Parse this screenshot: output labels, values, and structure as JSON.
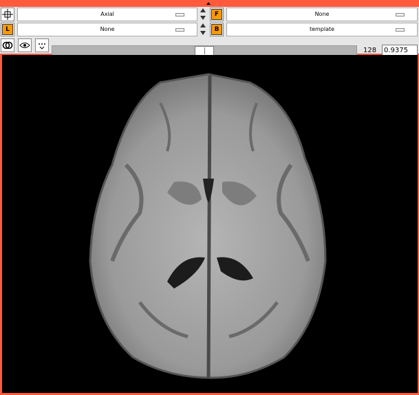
{
  "toolbar": {
    "view_select": "Axial",
    "overlay_select_top": "None",
    "overlay_select_left": "None",
    "template_select": "template",
    "slice_index": "128",
    "scale_value": "0.9375",
    "slice_position_fraction": 0.5
  },
  "badges": {
    "f_label": "F",
    "l_label": "L",
    "b_label": "B"
  },
  "icons": [
    "crosshair-icon",
    "layer-icon",
    "link-rings-icon",
    "eye-icon",
    "dots-dropdown-icon"
  ],
  "colors": {
    "frame": "#ff5a3c",
    "panel": "#e6e6e6",
    "badge": "#ff9a00"
  }
}
